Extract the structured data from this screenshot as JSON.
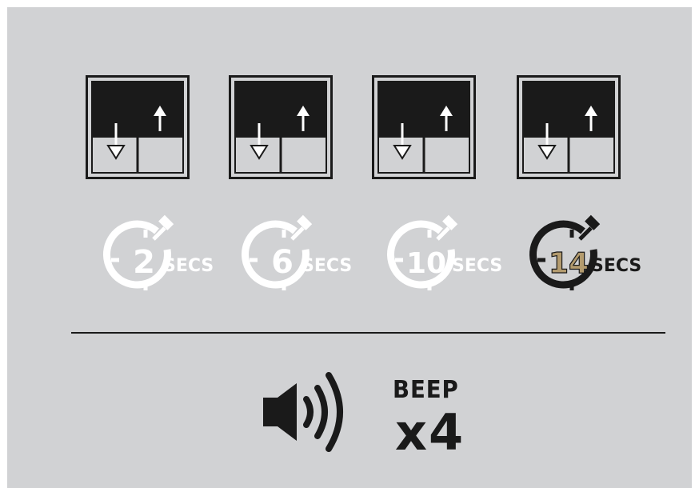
{
  "steps": [
    {
      "window_icon": "window-up-down-arrows-icon",
      "timer_icon": "stopwatch-icon",
      "number": "2",
      "unit": "SECS",
      "active": false
    },
    {
      "window_icon": "window-up-down-arrows-icon",
      "timer_icon": "stopwatch-icon",
      "number": "6",
      "unit": "SECS",
      "active": false
    },
    {
      "window_icon": "window-up-down-arrows-icon",
      "timer_icon": "stopwatch-icon",
      "number": "10",
      "unit": "SECS",
      "active": false
    },
    {
      "window_icon": "window-up-down-arrows-icon",
      "timer_icon": "stopwatch-icon",
      "number": "14",
      "unit": "SECS",
      "active": true
    }
  ],
  "beep": {
    "icon": "speaker-sound-icon",
    "label": "BEEP",
    "count": "x4"
  },
  "colors": {
    "background": "#d1d2d4",
    "inactive": "#ffffff",
    "active": "#1a1a1a",
    "active_number": "#b39b6e",
    "window_fill": "#1a1a1a"
  }
}
